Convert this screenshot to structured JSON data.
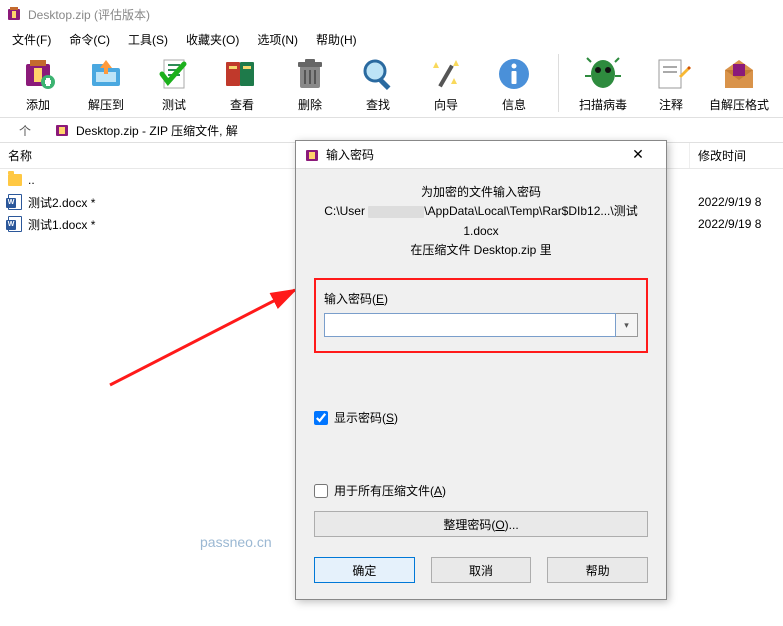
{
  "window": {
    "title": "Desktop.zip (评估版本)"
  },
  "menu": {
    "file": "文件(F)",
    "cmd": "命令(C)",
    "tools": "工具(S)",
    "fav": "收藏夹(O)",
    "opt": "选项(N)",
    "help": "帮助(H)"
  },
  "toolbar": {
    "add": "添加",
    "extract": "解压到",
    "test": "测试",
    "view": "查看",
    "delete": "删除",
    "find": "查找",
    "wizard": "向导",
    "info": "信息",
    "scan": "扫描病毒",
    "comment": "注释",
    "sfx": "自解压格式"
  },
  "address": {
    "up": "个",
    "path": "Desktop.zip - ZIP 压缩文件, 解"
  },
  "columns": {
    "name": "名称",
    "date": "修改时间"
  },
  "rows": {
    "up": "..",
    "f1_name": "测试2.docx *",
    "f1_date": "2022/9/19 8",
    "f2_name": "测试1.docx *",
    "f2_date": "2022/9/19 8"
  },
  "dialog": {
    "title": "输入密码",
    "msg1": "为加密的文件输入密码",
    "msg2a": "C:\\User",
    "msg2b": "\\AppData\\Local\\Temp\\Rar$DIb12...\\测试1.docx",
    "msg3": "在压缩文件 Desktop.zip 里",
    "input_label_a": "输入密码(",
    "input_label_u": "E",
    "input_label_b": ")",
    "show_a": "显示密码(",
    "show_u": "S",
    "show_b": ")",
    "all_a": "用于所有压缩文件(",
    "all_u": "A",
    "all_b": ")",
    "manage_a": "整理密码(",
    "manage_u": "O",
    "manage_b": ")...",
    "ok": "确定",
    "cancel": "取消",
    "help": "帮助"
  },
  "watermark": "passneo.cn"
}
